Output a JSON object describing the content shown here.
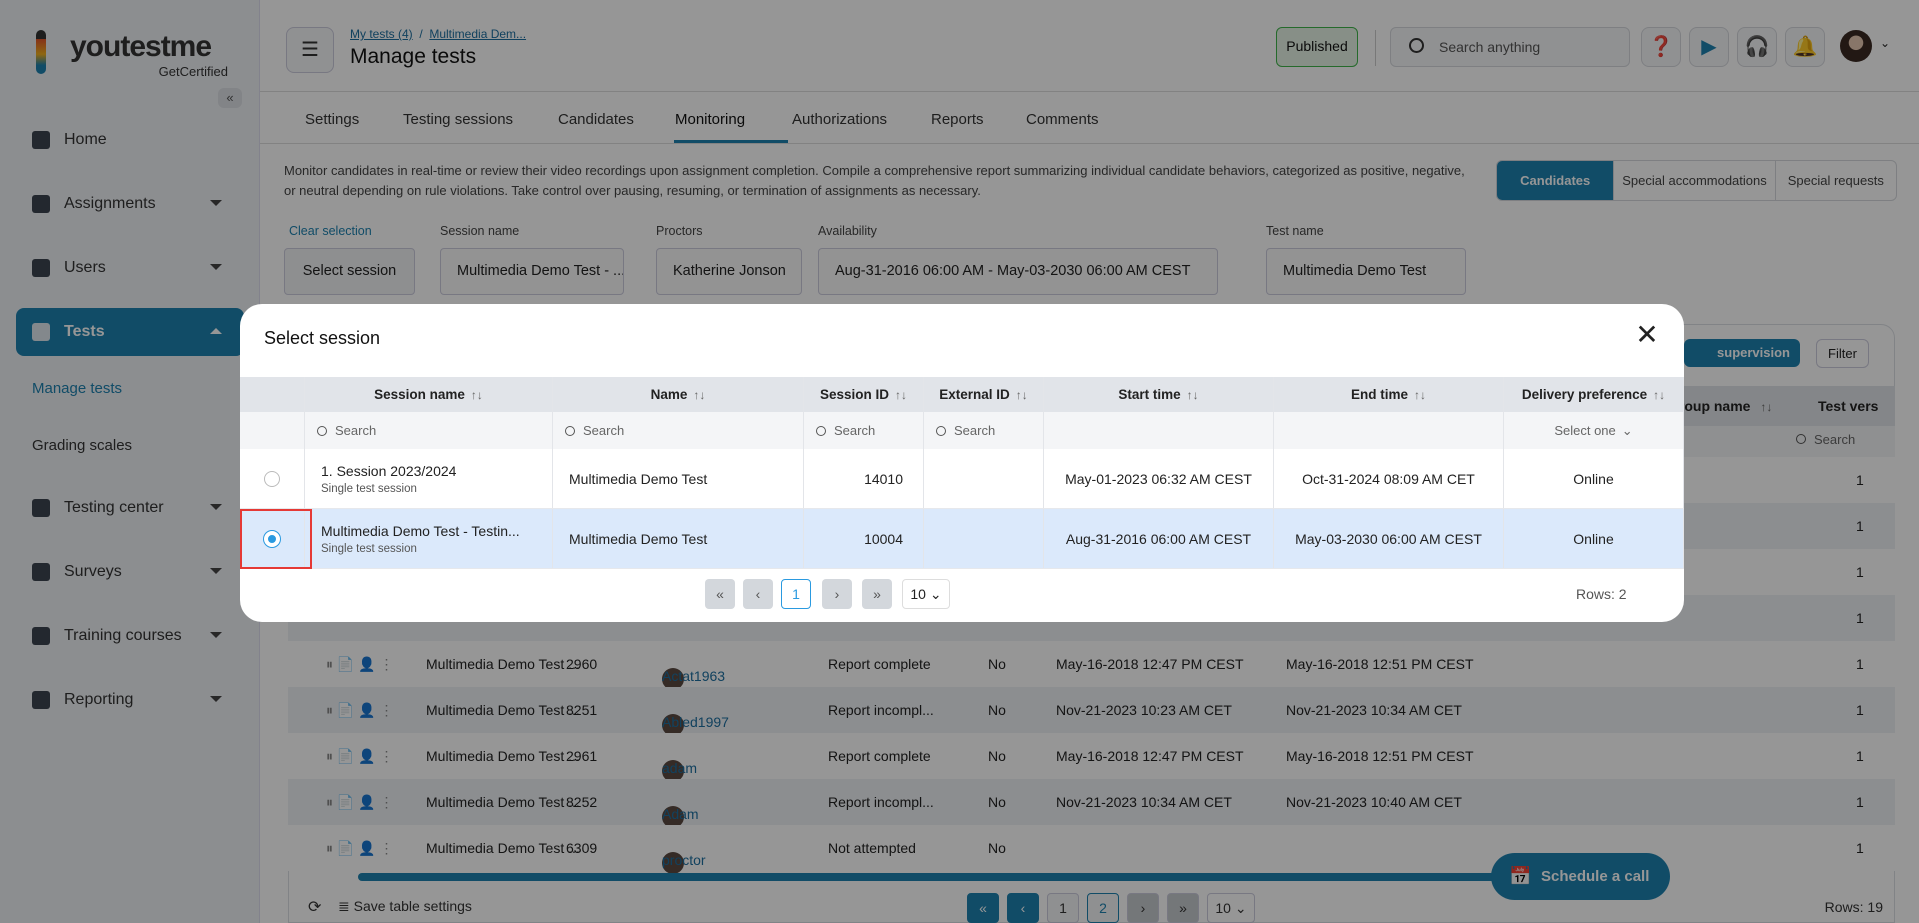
{
  "brand": {
    "name": "youtestme",
    "tagline": "GetCertified"
  },
  "sidebar": {
    "items": [
      {
        "label": "Home",
        "icon": "home-icon",
        "top": 0
      },
      {
        "label": "Assignments",
        "icon": "assignments-icon",
        "caret": true
      },
      {
        "label": "Users",
        "icon": "users-icon",
        "caret": true
      },
      {
        "label": "Tests",
        "icon": "tests-icon",
        "caret": true,
        "active": true
      },
      {
        "label": "Testing center",
        "icon": "testing-center-icon",
        "caret": true
      },
      {
        "label": "Surveys",
        "icon": "surveys-icon",
        "caret": true
      },
      {
        "label": "Training courses",
        "icon": "trophy-icon",
        "caret": true
      },
      {
        "label": "Reporting",
        "icon": "reporting-icon",
        "caret": true
      }
    ],
    "sub_items": [
      {
        "label": "Manage tests",
        "active": true
      },
      {
        "label": "Grading scales"
      }
    ]
  },
  "header": {
    "breadcrumb": [
      "My tests (4)",
      "Multimedia Dem..."
    ],
    "title": "Manage tests",
    "status": "Published",
    "search_placeholder": "Search anything"
  },
  "tabs": [
    "Settings",
    "Testing sessions",
    "Candidates",
    "Monitoring",
    "Authorizations",
    "Reports",
    "Comments"
  ],
  "active_tab": "Monitoring",
  "description": "Monitor candidates in real-time or review their video recordings upon assignment completion. Compile a comprehensive report summarizing individual candidate behaviors, categorized as positive, negative, or neutral depending on rule violations. Take control over pausing, resuming, or termination of assignments as necessary.",
  "segments": [
    "Candidates",
    "Special accommodations",
    "Special requests"
  ],
  "filters": {
    "clear": "Clear selection",
    "select_session": "Select session",
    "session_label": "Session name",
    "session_value": "Multimedia Demo Test - ...",
    "proctors_label": "Proctors",
    "proctors_value": "Katherine Jonson",
    "availability_label": "Availability",
    "availability_value": "Aug-31-2016 06:00 AM - May-03-2030 06:00 AM CEST",
    "testname_label": "Test name",
    "testname_value": "Multimedia Demo Test"
  },
  "bg_table": {
    "supervision_label": "supervision mode",
    "filter_label": "Filter",
    "headers": {
      "group": "Group name",
      "version": "Test vers"
    },
    "search": "Search",
    "rows": [
      {
        "version": "1"
      },
      {
        "version": "1"
      },
      {
        "version": "1"
      },
      {
        "version": "1"
      },
      {
        "session": "Multimedia Demo Test ...",
        "id": "2960",
        "user": "Actat1963",
        "status": "Report complete",
        "flag": "No",
        "start": "May-16-2018 12:47 PM CEST",
        "end": "May-16-2018 12:51 PM CEST",
        "version": "1"
      },
      {
        "session": "Multimedia Demo Test ...",
        "id": "8251",
        "user": "Abled1997",
        "status": "Report incompl...",
        "flag": "No",
        "start": "Nov-21-2023 10:23 AM CET",
        "end": "Nov-21-2023 10:34 AM CET",
        "version": "1"
      },
      {
        "session": "Multimedia Demo Test ...",
        "id": "2961",
        "user": "adam",
        "status": "Report complete",
        "flag": "No",
        "start": "May-16-2018 12:47 PM CEST",
        "end": "May-16-2018 12:51 PM CEST",
        "version": "1"
      },
      {
        "session": "Multimedia Demo Test ...",
        "id": "8252",
        "user": "Adam",
        "status": "Report incompl...",
        "flag": "No",
        "start": "Nov-21-2023 10:34 AM CET",
        "end": "Nov-21-2023 10:40 AM CET",
        "version": "1"
      },
      {
        "session": "Multimedia Demo Test ...",
        "id": "6309",
        "user": "proctor",
        "status": "Not attempted",
        "flag": "No",
        "start": "",
        "end": "",
        "version": "1"
      }
    ],
    "footer": {
      "save": "Save table settings",
      "pages": [
        "1",
        "2"
      ],
      "current_page": "2",
      "page_size": "10",
      "rows": "Rows: 19"
    }
  },
  "schedule_call": "Schedule a call",
  "modal": {
    "title": "Select session",
    "columns": [
      "Session name",
      "Name",
      "Session ID",
      "External ID",
      "Start time",
      "End time",
      "Delivery preference"
    ],
    "search_placeholder": "Search",
    "select_placeholder": "Select one",
    "rows": [
      {
        "session": "1. Session 2023/2024",
        "type": "Single test session",
        "name": "Multimedia Demo Test",
        "id": "14010",
        "external": "",
        "start": "May-01-2023 06:32 AM CEST",
        "end": "Oct-31-2024 08:09 AM CET",
        "delivery": "Online",
        "selected": false
      },
      {
        "session": "Multimedia Demo Test - Testin...",
        "type": "Single test session",
        "name": "Multimedia Demo Test",
        "id": "10004",
        "external": "",
        "start": "Aug-31-2016 06:00 AM CEST",
        "end": "May-03-2030 06:00 AM CEST",
        "delivery": "Online",
        "selected": true
      }
    ],
    "pagination": {
      "current": "1",
      "page_size": "10",
      "rows": "Rows: 2"
    }
  },
  "colors": {
    "accent": "#1d82b0",
    "published": "#3fb54a",
    "selected_row": "#dbe9fb",
    "highlight": "#e53935"
  }
}
